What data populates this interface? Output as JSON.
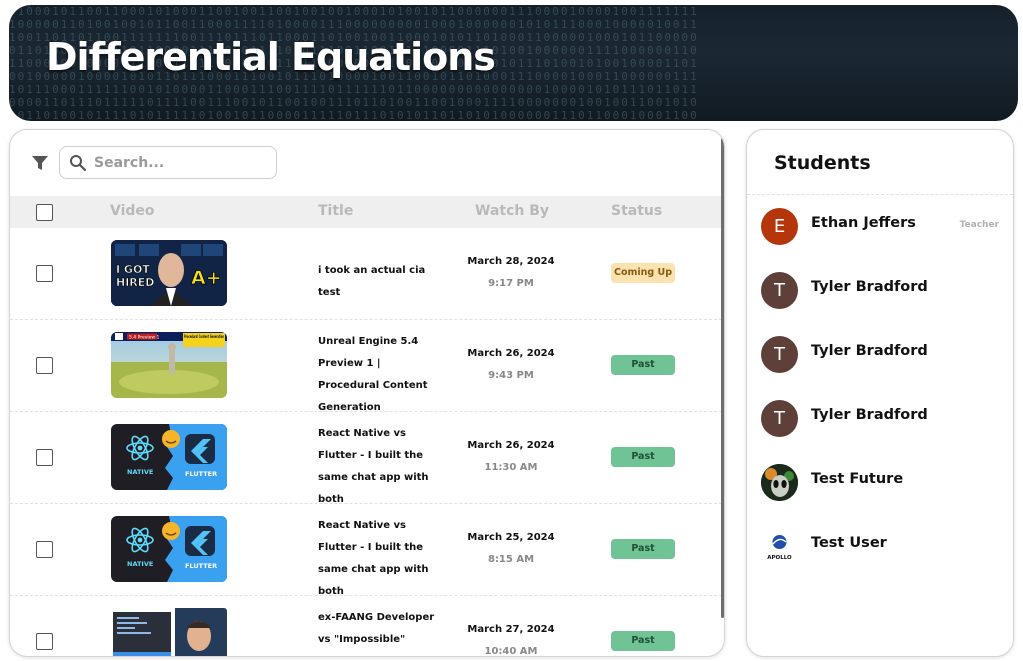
{
  "course": {
    "title": "Differential Equations"
  },
  "search": {
    "placeholder": "Search..."
  },
  "table": {
    "headers": {
      "video": "Video",
      "title": "Title",
      "watch_by": "Watch By",
      "status": "Status"
    },
    "rows": [
      {
        "title": "i took an actual cia test",
        "date": "March 28, 2024",
        "time": "9:17 PM",
        "status": "Coming Up",
        "thumb": "cia-test-thumbnail",
        "thumb_text": [
          "I GOT",
          "HIRED",
          "A+"
        ]
      },
      {
        "title": "Unreal Engine 5.4 Preview 1 | Procedural Content Generation",
        "date": "March 26, 2024",
        "time": "9:43 PM",
        "status": "Past",
        "thumb": "unreal-engine-thumbnail",
        "thumb_text": [
          "5.4 Preview 1",
          "Procedural Content Generation"
        ]
      },
      {
        "title": "React Native vs Flutter - I built the same chat app with both",
        "date": "March 26, 2024",
        "time": "11:30 AM",
        "status": "Past",
        "thumb": "react-native-flutter-thumbnail",
        "thumb_text": [
          "NATIVE",
          "FLUTTER"
        ]
      },
      {
        "title": "React Native vs Flutter - I built the same chat app with both",
        "date": "March 25, 2024",
        "time": "8:15 AM",
        "status": "Past",
        "thumb": "react-native-flutter-thumbnail",
        "thumb_text": [
          "NATIVE",
          "FLUTTER"
        ]
      },
      {
        "title": "ex-FAANG Developer vs \"Impossible\" JavaScript",
        "date": "March 27, 2024",
        "time": "10:40 AM",
        "status": "Past",
        "thumb": "faang-developer-thumbnail",
        "thumb_text": []
      }
    ]
  },
  "students": {
    "heading": "Students",
    "list": [
      {
        "name": "Ethan Jeffers",
        "role": "Teacher",
        "initial": "E",
        "color": "#b5360b"
      },
      {
        "name": "Tyler Bradford",
        "role": "",
        "initial": "T",
        "color": "#5e4038"
      },
      {
        "name": "Tyler Bradford",
        "role": "",
        "initial": "T",
        "color": "#5e4038"
      },
      {
        "name": "Tyler Bradford",
        "role": "",
        "initial": "T",
        "color": "#5e4038"
      },
      {
        "name": "Test Future",
        "role": "",
        "initial": "",
        "color": "#1c2a1c"
      },
      {
        "name": "Test User",
        "role": "",
        "initial": "",
        "color": "#ffffff",
        "logo_text": "APOLLO"
      }
    ]
  },
  "colors": {
    "coming_up_bg": "#fbe2ae",
    "past_bg": "#6fc394",
    "banner_bg": "#15202b"
  }
}
